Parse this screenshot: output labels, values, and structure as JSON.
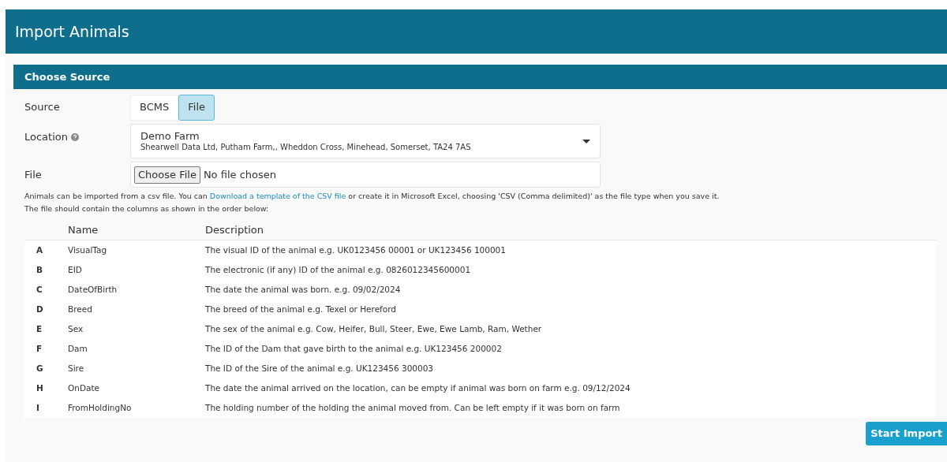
{
  "page_title": "Import Animals",
  "panel": {
    "title": "Choose Source",
    "source": {
      "label": "Source",
      "options": [
        {
          "label": "BCMS",
          "selected": false
        },
        {
          "label": "File",
          "selected": true
        }
      ]
    },
    "location": {
      "label": "Location",
      "value": "Demo Farm",
      "detail": "Shearwell Data Ltd, Putham Farm,, Wheddon Cross, Minehead, Somerset, TA24 7AS"
    },
    "file": {
      "label": "File",
      "button": "Choose File",
      "status": "No file chosen"
    },
    "help": {
      "before": "Animals can be imported from a csv file. You can ",
      "link": "Download a template of the CSV file",
      "after": " or create it in Microsoft Excel, choosing 'CSV (Comma delimited)' as the file type when you save it.",
      "line2": "The file should contain the columns as shown in the order below:"
    },
    "table": {
      "columns": [
        "Name",
        "Description"
      ],
      "rows": [
        {
          "letter": "A",
          "name": "VisualTag",
          "description": "The visual ID of the animal e.g. UK0123456 00001 or UK123456 100001"
        },
        {
          "letter": "B",
          "name": "EID",
          "description": "The electronic (if any) ID of the animal e.g. 0826012345600001"
        },
        {
          "letter": "C",
          "name": "DateOfBirth",
          "description": "The date the animal was born. e.g. 09/02/2024"
        },
        {
          "letter": "D",
          "name": "Breed",
          "description": "The breed of the animal e.g. Texel or Hereford"
        },
        {
          "letter": "E",
          "name": "Sex",
          "description": "The sex of the animal e.g. Cow, Heifer, Bull, Steer, Ewe, Ewe Lamb, Ram, Wether"
        },
        {
          "letter": "F",
          "name": "Dam",
          "description": "The ID of the Dam that gave birth to the animal e.g. UK123456 200002"
        },
        {
          "letter": "G",
          "name": "Sire",
          "description": "The ID of the Sire of the animal e.g. UK123456 300003"
        },
        {
          "letter": "H",
          "name": "OnDate",
          "description": "The date the animal arrived on the location, can be empty if animal was born on farm e.g. 09/12/2024"
        },
        {
          "letter": "I",
          "name": "FromHoldingNo",
          "description": "The holding number of the holding the animal moved from. Can be left empty if it was born on farm"
        }
      ]
    }
  },
  "start_button": "Start Import"
}
